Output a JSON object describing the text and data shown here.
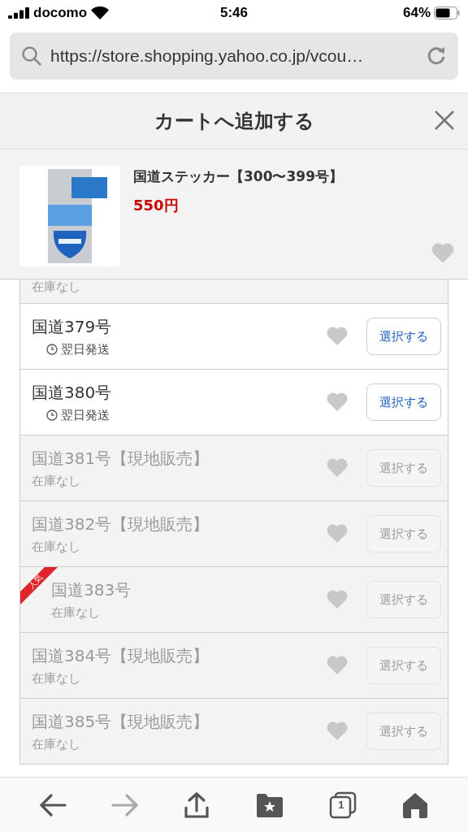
{
  "status_bar": {
    "carrier": "docomo",
    "time": "5:46",
    "battery": "64%"
  },
  "address_bar": {
    "url": "https://store.shopping.yahoo.co.jp/vcou…"
  },
  "sheet": {
    "title": "カートへ追加する"
  },
  "product": {
    "name": "国道ステッカー【300〜399号】",
    "price": "550円"
  },
  "partial_row": {
    "stock": "在庫なし"
  },
  "variants": [
    {
      "name": "国道379号",
      "shipping": "翌日発送",
      "available": true,
      "popular": false,
      "button": "選択する"
    },
    {
      "name": "国道380号",
      "shipping": "翌日発送",
      "available": true,
      "popular": false,
      "button": "選択する"
    },
    {
      "name": "国道381号【現地販売】",
      "stock": "在庫なし",
      "available": false,
      "popular": false,
      "button": "選択する"
    },
    {
      "name": "国道382号【現地販売】",
      "stock": "在庫なし",
      "available": false,
      "popular": false,
      "button": "選択する"
    },
    {
      "name": "国道383号",
      "stock": "在庫なし",
      "available": false,
      "popular": true,
      "badge": "人気",
      "button": "選択する"
    },
    {
      "name": "国道384号【現地販売】",
      "stock": "在庫なし",
      "available": false,
      "popular": false,
      "button": "選択する"
    },
    {
      "name": "国道385号【現地販売】",
      "stock": "在庫なし",
      "available": false,
      "popular": false,
      "button": "選択する"
    }
  ],
  "toolbar": {
    "tab_count": "1"
  }
}
